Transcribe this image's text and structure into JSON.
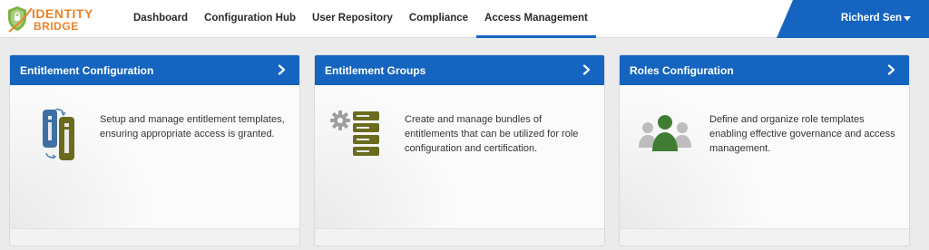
{
  "brand": {
    "line1": "IDENTITY",
    "line2": "BRIDGE"
  },
  "nav": {
    "items": [
      {
        "label": "Dashboard"
      },
      {
        "label": "Configuration Hub"
      },
      {
        "label": "User Repository"
      },
      {
        "label": "Compliance"
      },
      {
        "label": "Access Management"
      }
    ],
    "active": "Access Management"
  },
  "user": {
    "name": "Richerd Sen"
  },
  "cards": [
    {
      "title": "Entitlement Configuration",
      "description": "Setup and manage entitlement templates, ensuring appropriate access is granted.",
      "icon": "entitlement-icon"
    },
    {
      "title": "Entitlement Groups",
      "description": "Create and manage bundles of entitlements that can be utilized for role configuration and certification.",
      "icon": "gear-server-icon"
    },
    {
      "title": "Roles Configuration",
      "description": "Define and organize role templates enabling effective governance and access management.",
      "icon": "users-group-icon"
    }
  ],
  "colors": {
    "primary": "#1565c0",
    "brand": "#e8832a",
    "olive": "#6b6b1e",
    "green": "#3e7d32",
    "gray": "#9e9e9e"
  }
}
